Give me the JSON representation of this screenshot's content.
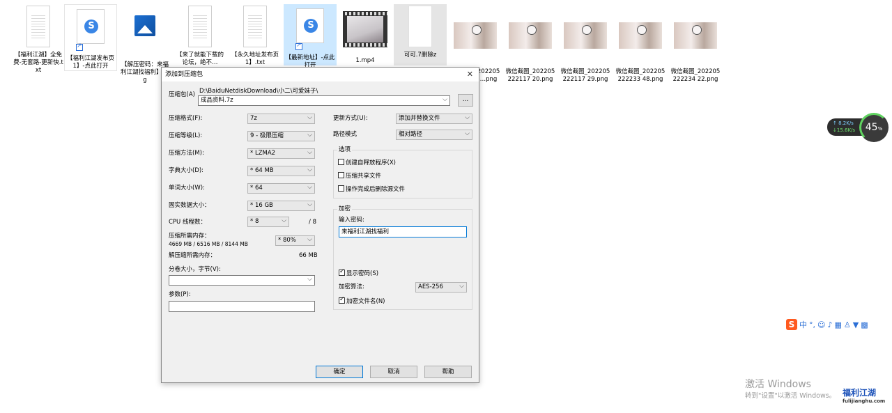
{
  "desktop": {
    "icons": [
      {
        "label": "【福利江湖】全免费-无套路-更新快.txt"
      },
      {
        "label": "【福利江湖发布页1】-点此打开"
      },
      {
        "label": "【解压密码：来福利江湖找福利】.jpg"
      },
      {
        "label": "【来了就能下载的论坛，绝不…"
      },
      {
        "label": "【永久地址发布页1】.txt"
      },
      {
        "label": "【最新地址】-点此打开"
      },
      {
        "label": "1.mp4"
      },
      {
        "label": "可可.7删除z"
      },
      {
        "label": "微信截图_2022052221172…png"
      },
      {
        "label": "微信截图_202205222117 20.png"
      },
      {
        "label": "微信截图_202205222117 29.png"
      },
      {
        "label": "微信截图_202205222233 48.png"
      },
      {
        "label": "微信截图_202205222234 22.png"
      }
    ]
  },
  "dialog": {
    "title": "添加到压缩包",
    "archive_label": "压缩包(A)",
    "archive_path": "D:\\BaiduNetdiskDownload\\小二\\可爱妹子\\",
    "archive_name": "成品资料.7z",
    "browse": "...",
    "format_label": "压缩格式(F):",
    "format_value": "7z",
    "level_label": "压缩等级(L):",
    "level_value": "9 - 极限压缩",
    "method_label": "压缩方法(M):",
    "method_value": "* LZMA2",
    "dict_label": "字典大小(D):",
    "dict_value": "* 64 MB",
    "word_label": "单词大小(W):",
    "word_value": "* 64",
    "solid_label": "固实数据大小：",
    "solid_value": "* 16 GB",
    "cpu_label": "CPU 线程数：",
    "cpu_value": "* 8",
    "cpu_total": "/ 8",
    "mem_label": "压缩所需内存：",
    "mem_value": "4669 MB / 6516 MB / 8144 MB",
    "mem_pct": "* 80%",
    "decomp_label": "解压缩所需内存：",
    "decomp_value": "66 MB",
    "split_label": "分卷大小，字节(V):",
    "split_value": "",
    "params_label": "参数(P):",
    "params_value": "",
    "update_label": "更新方式(U):",
    "update_value": "添加并替换文件",
    "pathmode_label": "路径模式",
    "pathmode_value": "相对路径",
    "options_title": "选项",
    "opt_sfx": "创建自释放程序(X)",
    "opt_shared": "压缩共享文件",
    "opt_delete": "操作完成后删除源文件",
    "enc_title": "加密",
    "pwd_label": "输入密码:",
    "pwd_value": "来福利江湖找福利",
    "show_pwd": "显示密码(S)",
    "enc_method_label": "加密算法:",
    "enc_method_value": "AES-256",
    "enc_names": "加密文件名(N)",
    "ok": "确定",
    "cancel": "取消",
    "help": "帮助"
  },
  "net_widget": {
    "up": "↑ 8.2K/s",
    "down": "↓15.6K/s",
    "percent": "45",
    "unit": "%"
  },
  "ime": {
    "s": "S",
    "lang": "中"
  },
  "watermark": {
    "line1": "激活 Windows",
    "line2": "转到\"设置\"以激活 Windows。",
    "logo": "福利江湖",
    "logo_url": "fulijianghu.com"
  }
}
